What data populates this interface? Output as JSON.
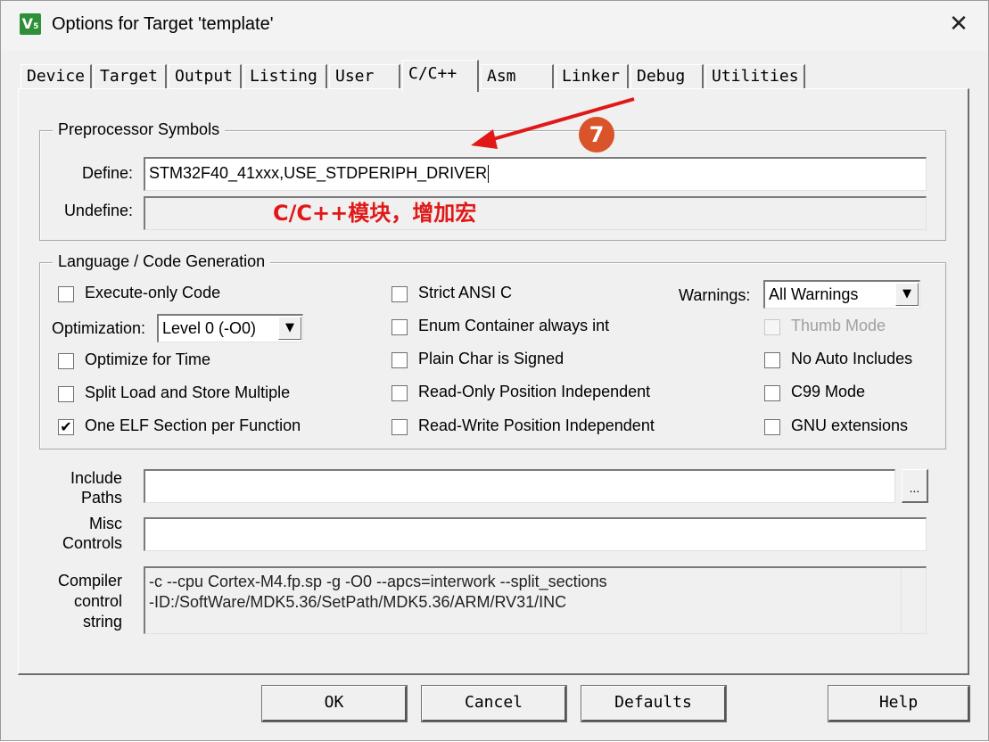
{
  "window": {
    "title": "Options for Target 'template'",
    "app_icon": "keil-uvision-icon",
    "close_glyph": "✕"
  },
  "tabs": [
    {
      "label": "Device",
      "active": false
    },
    {
      "label": "Target",
      "active": false
    },
    {
      "label": "Output",
      "active": false
    },
    {
      "label": "Listing",
      "active": false
    },
    {
      "label": "User",
      "active": false
    },
    {
      "label": "C/C++",
      "active": true
    },
    {
      "label": "Asm",
      "active": false
    },
    {
      "label": "Linker",
      "active": false
    },
    {
      "label": "Debug",
      "active": false
    },
    {
      "label": "Utilities",
      "active": false
    }
  ],
  "preprocessor": {
    "title": "Preprocessor Symbols",
    "define_label": "Define:",
    "define_value": "STM32F40_41xxx,USE_STDPERIPH_DRIVER",
    "undefine_label": "Undefine:",
    "undefine_value": ""
  },
  "language": {
    "title": "Language / Code Generation",
    "execute_only": {
      "label": "Execute-only Code",
      "checked": false
    },
    "optimization_label": "Optimization:",
    "optimization_value": "Level 0 (-O0)",
    "optimize_time": {
      "label": "Optimize for Time",
      "checked": false
    },
    "split_load": {
      "label": "Split Load and Store Multiple",
      "checked": false
    },
    "one_elf": {
      "label": "One ELF Section per Function",
      "checked": true
    },
    "strict_ansi": {
      "label": "Strict ANSI C",
      "checked": false
    },
    "enum_container": {
      "label": "Enum Container always int",
      "checked": false
    },
    "plain_char": {
      "label": "Plain Char is Signed",
      "checked": false
    },
    "ro_pos": {
      "label": "Read-Only Position Independent",
      "checked": false
    },
    "rw_pos": {
      "label": "Read-Write Position Independent",
      "checked": false
    },
    "warnings_label": "Warnings:",
    "warnings_value": "All Warnings",
    "thumb_mode": {
      "label": "Thumb Mode",
      "checked": false,
      "disabled": true
    },
    "no_auto_includes": {
      "label": "No Auto Includes",
      "checked": false
    },
    "c99_mode": {
      "label": "C99 Mode",
      "checked": false
    },
    "gnu_ext": {
      "label": "GNU extensions",
      "checked": false
    }
  },
  "paths": {
    "include_label_1": "Include",
    "include_label_2": "Paths",
    "include_value": "",
    "browse_label": "...",
    "misc_label_1": "Misc",
    "misc_label_2": "Controls",
    "misc_value": "",
    "compiler_label_1": "Compiler",
    "compiler_label_2": "control",
    "compiler_label_3": "string",
    "compiler_line_1": "-c --cpu Cortex-M4.fp.sp -g -O0 --apcs=interwork --split_sections",
    "compiler_line_2": "-ID:/SoftWare/MDK5.36/SetPath/MDK5.36/ARM/RV31/INC"
  },
  "buttons": {
    "ok": "OK",
    "cancel": "Cancel",
    "defaults": "Defaults",
    "help": "Help"
  },
  "annotation": {
    "step_number": "7",
    "text": "C/C++模块，增加宏",
    "color": "#e01818"
  }
}
